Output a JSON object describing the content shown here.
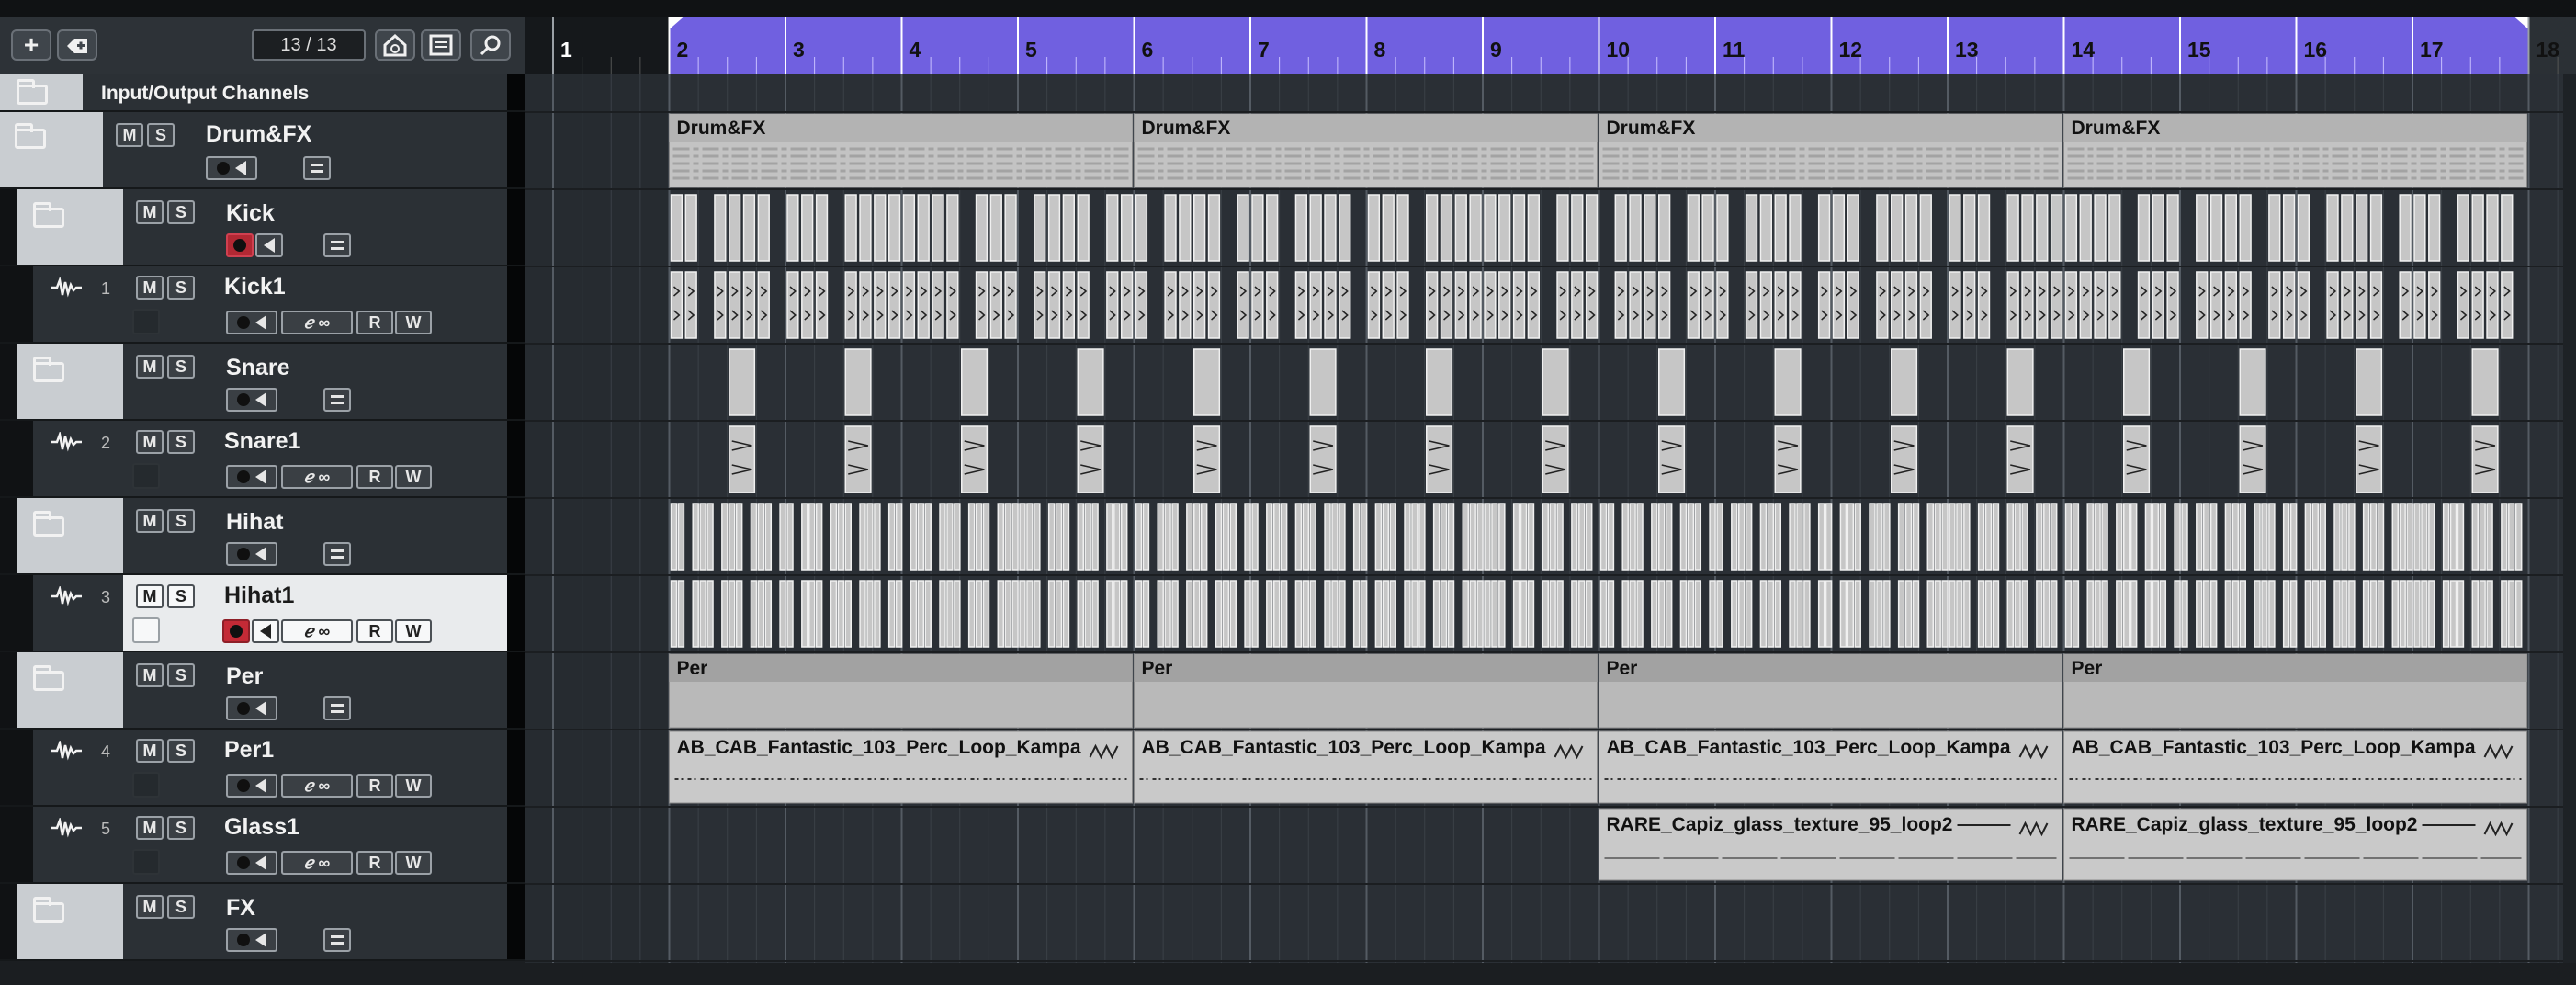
{
  "toolbar": {
    "add_label": "+",
    "counter": "13 / 13"
  },
  "io_channels": {
    "label": "Input/Output Channels"
  },
  "tracks": [
    {
      "name": "Drum&FX",
      "type": "folder",
      "m": "M",
      "s": "S"
    },
    {
      "name": "Kick",
      "type": "folder",
      "m": "M",
      "s": "S"
    },
    {
      "name": "Kick1",
      "type": "audio",
      "number": "1",
      "m": "M",
      "s": "S",
      "r": "R",
      "w": "W"
    },
    {
      "name": "Snare",
      "type": "folder",
      "m": "M",
      "s": "S"
    },
    {
      "name": "Snare1",
      "type": "audio",
      "number": "2",
      "m": "M",
      "s": "S",
      "r": "R",
      "w": "W"
    },
    {
      "name": "Hihat",
      "type": "folder",
      "m": "M",
      "s": "S"
    },
    {
      "name": "Hihat1",
      "type": "audio",
      "number": "3",
      "m": "M",
      "s": "S",
      "r": "R",
      "w": "W",
      "selected": true
    },
    {
      "name": "Per",
      "type": "folder",
      "m": "M",
      "s": "S"
    },
    {
      "name": "Per1",
      "type": "audio",
      "number": "4",
      "m": "M",
      "s": "S",
      "r": "R",
      "w": "W"
    },
    {
      "name": "Glass1",
      "type": "audio",
      "number": "5",
      "m": "M",
      "s": "S",
      "r": "R",
      "w": "W"
    },
    {
      "name": "FX",
      "type": "folder",
      "m": "M",
      "s": "S"
    }
  ],
  "ruler": {
    "bars": [
      "1",
      "2",
      "3",
      "4",
      "5",
      "6",
      "7",
      "8",
      "9",
      "10",
      "11",
      "12",
      "13",
      "14",
      "15",
      "16",
      "17",
      "18"
    ],
    "cycle_color": "#7060e0"
  },
  "parts": {
    "drum_fx": [
      "Drum&FX",
      "Drum&FX",
      "Drum&FX",
      "Drum&FX"
    ],
    "per": [
      "Per",
      "Per",
      "Per",
      "Per"
    ],
    "per1_events": [
      "AB_CAB_Fantastic_103_Perc_Loop_Kampa",
      "AB_CAB_Fantastic_103_Perc_Loop_Kampa",
      "AB_CAB_Fantastic_103_Perc_Loop_Kampa",
      "AB_CAB_Fantastic_103_Perc_Loop_Kampa"
    ],
    "glass1_events": [
      "RARE_Capiz_glass_texture_95_loop2",
      "RARE_Capiz_glass_texture_95_loop2"
    ]
  },
  "colors": {
    "part_bg": "#c8c8c8",
    "part_header": "#a9a9a9",
    "record_red": "#b22833",
    "selected_track": "#e9ebed"
  }
}
